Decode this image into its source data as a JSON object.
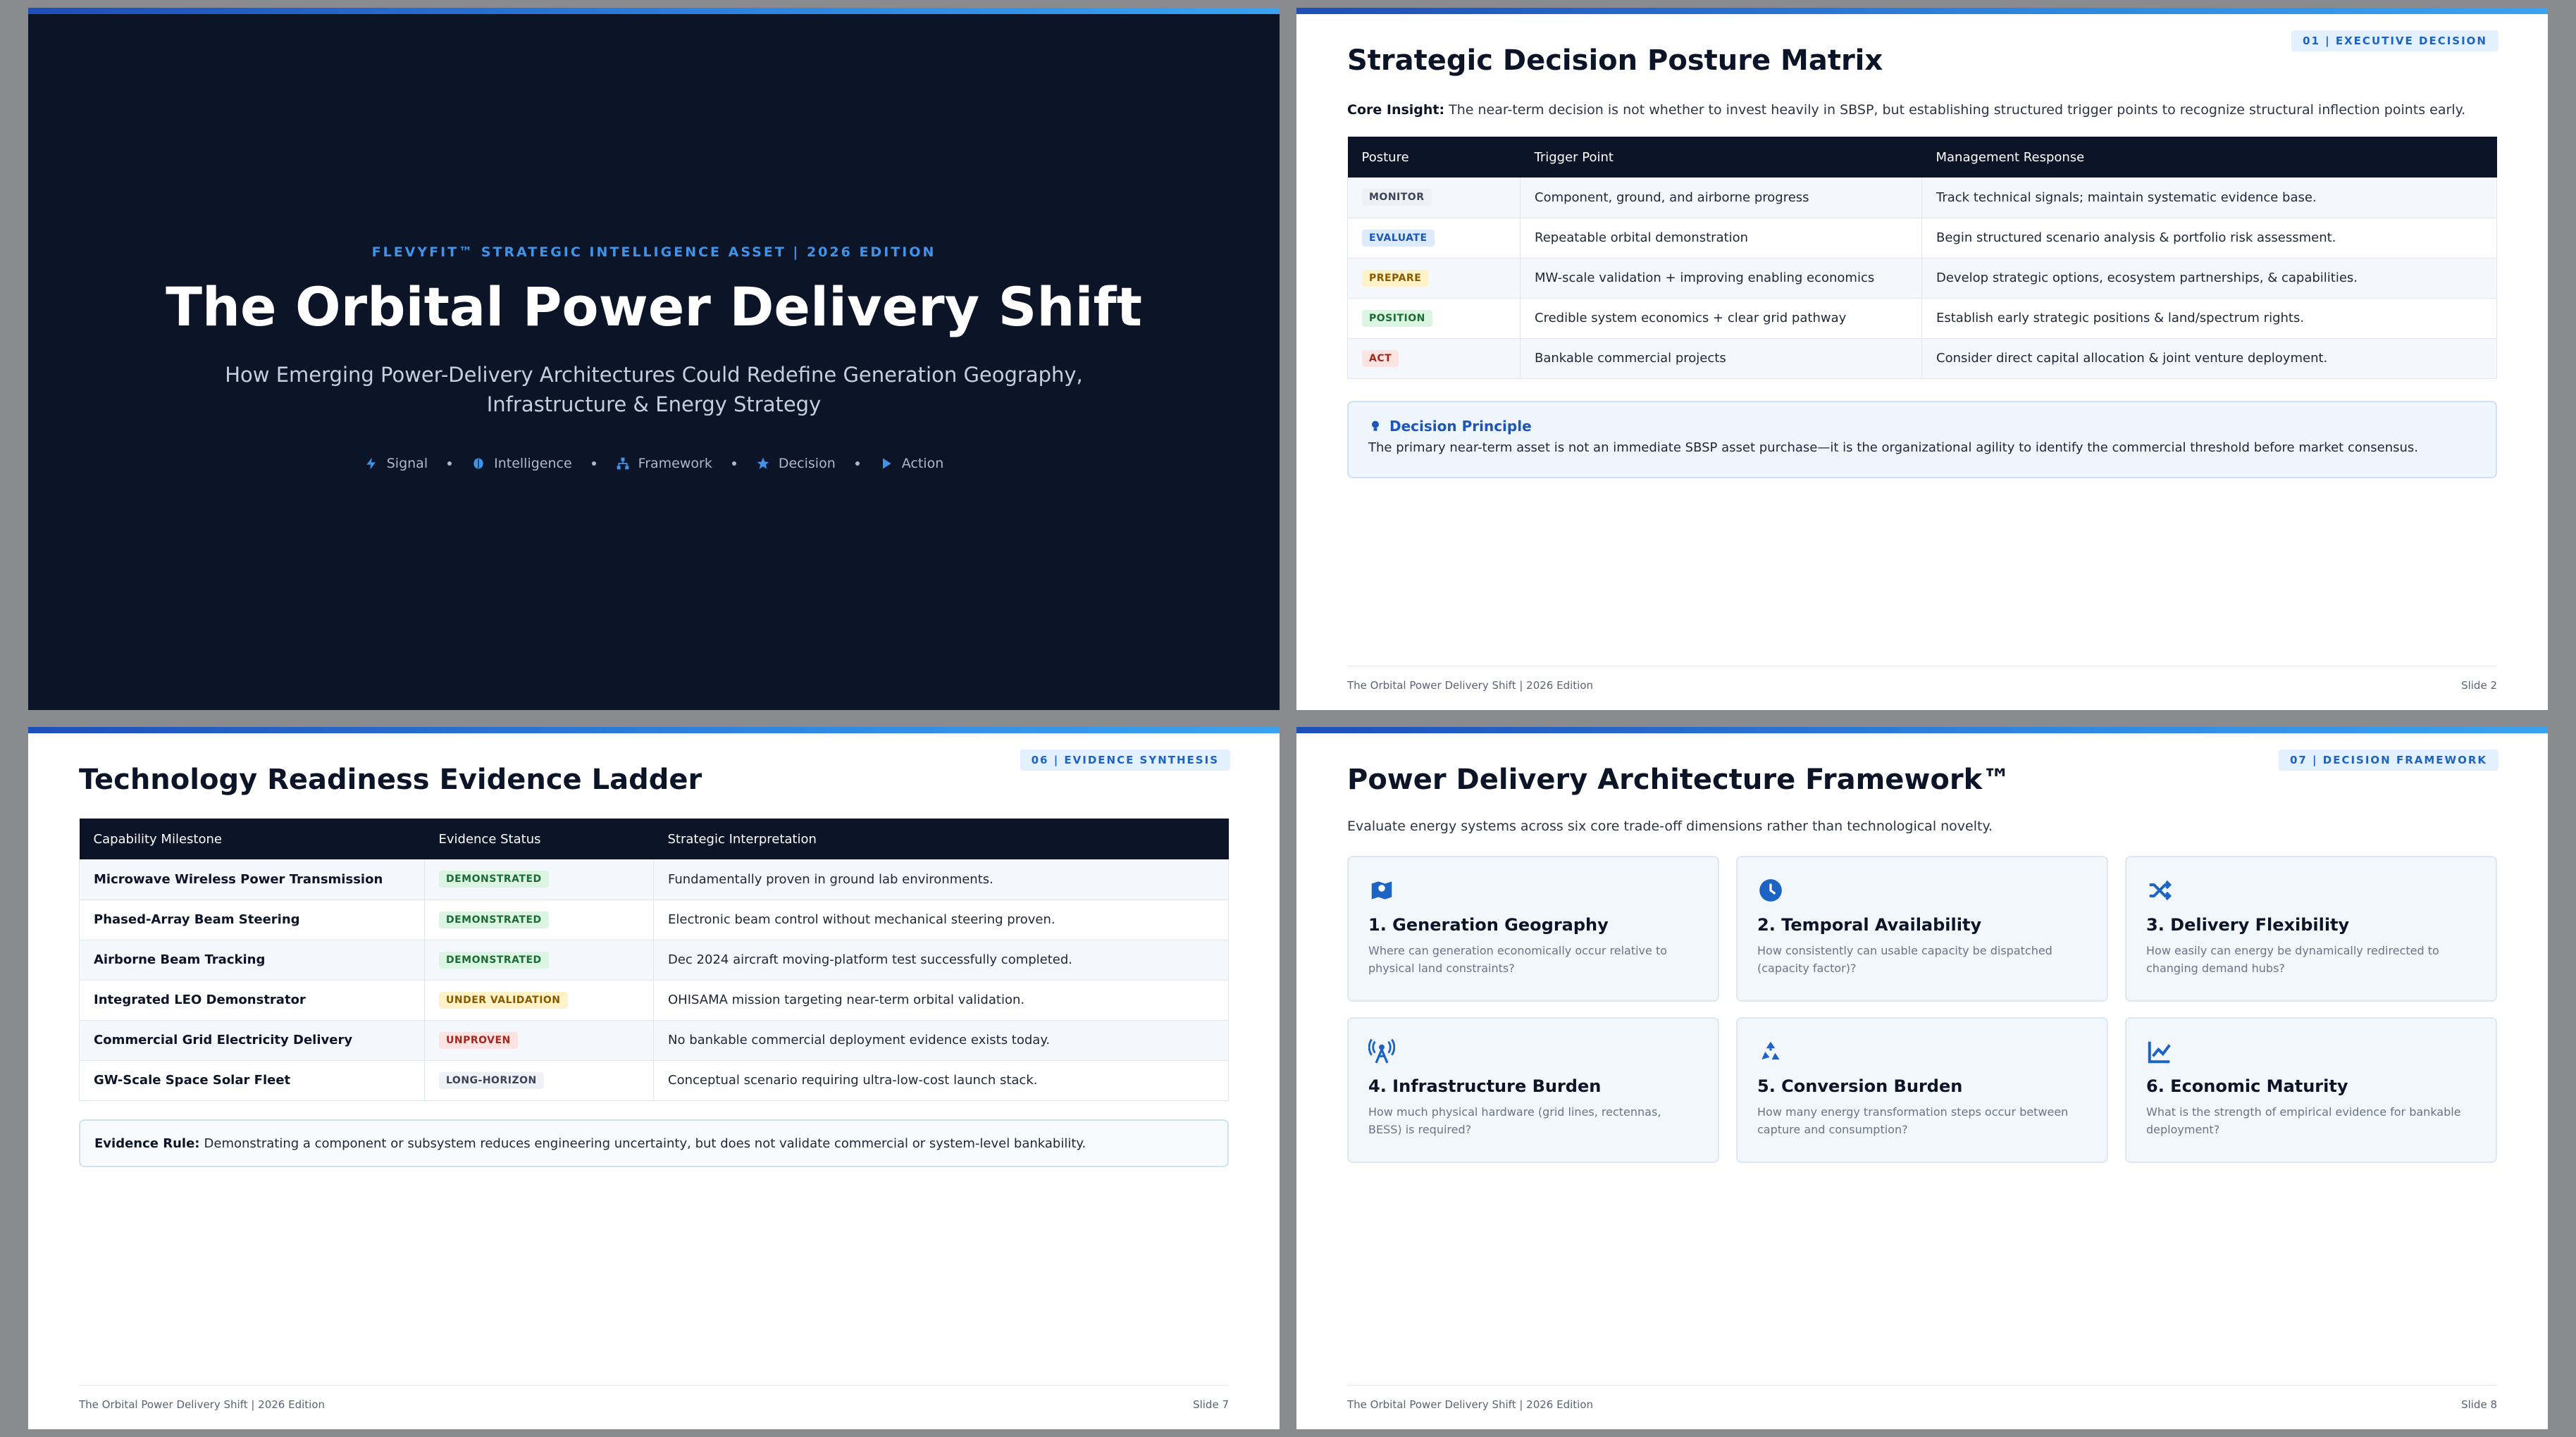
{
  "footer_text": "The Orbital Power Delivery Shift | 2026 Edition",
  "slide1": {
    "eyebrow": "FLEVYFIT™ STRATEGIC INTELLIGENCE ASSET | 2026 EDITION",
    "title": "The Orbital Power Delivery Shift",
    "subtitle_line1": "How Emerging Power-Delivery Architectures Could Redefine Generation Geography,",
    "subtitle_line2": "Infrastructure & Energy Strategy",
    "flow": [
      {
        "label": "Signal",
        "icon": "bolt-icon"
      },
      {
        "label": "Intelligence",
        "icon": "brain-icon"
      },
      {
        "label": "Framework",
        "icon": "hierarchy-icon"
      },
      {
        "label": "Decision",
        "icon": "star-icon"
      },
      {
        "label": "Action",
        "icon": "play-icon"
      }
    ]
  },
  "slide2": {
    "tag": "01 | EXECUTIVE DECISION",
    "title": "Strategic Decision Posture Matrix",
    "insight_label": "Core Insight:",
    "insight_text": "The near-term decision is not whether to invest heavily in SBSP, but establishing structured trigger points to recognize structural inflection points early.",
    "headers": [
      "Posture",
      "Trigger Point",
      "Management Response"
    ],
    "rows": [
      {
        "posture": "MONITOR",
        "trigger": "Component, ground, and airborne progress",
        "response": "Track technical signals; maintain systematic evidence base."
      },
      {
        "posture": "EVALUATE",
        "trigger": "Repeatable orbital demonstration",
        "response": "Begin structured scenario analysis & portfolio risk assessment."
      },
      {
        "posture": "PREPARE",
        "trigger": "MW-scale validation + improving enabling economics",
        "response": "Develop strategic options, ecosystem partnerships, & capabilities."
      },
      {
        "posture": "POSITION",
        "trigger": "Credible system economics + clear grid pathway",
        "response": "Establish early strategic positions & land/spectrum rights."
      },
      {
        "posture": "ACT",
        "trigger": "Bankable commercial projects",
        "response": "Consider direct capital allocation & joint venture deployment."
      }
    ],
    "principle_title": "Decision Principle",
    "principle_text": "The primary near-term asset is not an immediate SBSP asset purchase—it is the organizational agility to identify the commercial threshold before market consensus.",
    "slide_no": "Slide 2"
  },
  "slide3": {
    "tag": "06 | EVIDENCE SYNTHESIS",
    "title": "Technology Readiness Evidence Ladder",
    "headers": [
      "Capability Milestone",
      "Evidence Status",
      "Strategic Interpretation"
    ],
    "rows": [
      {
        "milestone": "Microwave Wireless Power Transmission",
        "status": "DEMONSTRATED",
        "interp": "Fundamentally proven in ground lab environments."
      },
      {
        "milestone": "Phased-Array Beam Steering",
        "status": "DEMONSTRATED",
        "interp": "Electronic beam control without mechanical steering proven."
      },
      {
        "milestone": "Airborne Beam Tracking",
        "status": "DEMONSTRATED",
        "interp": "Dec 2024 aircraft moving-platform test successfully completed."
      },
      {
        "milestone": "Integrated LEO Demonstrator",
        "status": "UNDER VALIDATION",
        "interp": "OHISAMA mission targeting near-term orbital validation."
      },
      {
        "milestone": "Commercial Grid Electricity Delivery",
        "status": "UNPROVEN",
        "interp": "No bankable commercial deployment evidence exists today."
      },
      {
        "milestone": "GW-Scale Space Solar Fleet",
        "status": "LONG-HORIZON",
        "interp": "Conceptual scenario requiring ultra-low-cost launch stack."
      }
    ],
    "rule_label": "Evidence Rule:",
    "rule_text": "Demonstrating a component or subsystem reduces engineering uncertainty, but does not validate commercial or system-level bankability.",
    "slide_no": "Slide 7"
  },
  "slide4": {
    "tag": "07 | DECISION FRAMEWORK",
    "title": "Power Delivery Architecture Framework™",
    "lead": "Evaluate energy systems across six core trade-off dimensions rather than technological novelty.",
    "cards": [
      {
        "title": "1. Generation Geography",
        "desc": "Where can generation economically occur relative to physical land constraints?",
        "icon": "map-icon"
      },
      {
        "title": "2. Temporal Availability",
        "desc": "How consistently can usable capacity be dispatched (capacity factor)?",
        "icon": "clock-icon"
      },
      {
        "title": "3. Delivery Flexibility",
        "desc": "How easily can energy be dynamically redirected to changing demand hubs?",
        "icon": "shuffle-icon"
      },
      {
        "title": "4. Infrastructure Burden",
        "desc": "How much physical hardware (grid lines, rectennas, BESS) is required?",
        "icon": "antenna-icon"
      },
      {
        "title": "5. Conversion Burden",
        "desc": "How many energy transformation steps occur between capture and consumption?",
        "icon": "recycle-icon"
      },
      {
        "title": "6. Economic Maturity",
        "desc": "What is the strength of empirical evidence for bankable deployment?",
        "icon": "chart-line-icon"
      }
    ],
    "slide_no": "Slide 8"
  }
}
